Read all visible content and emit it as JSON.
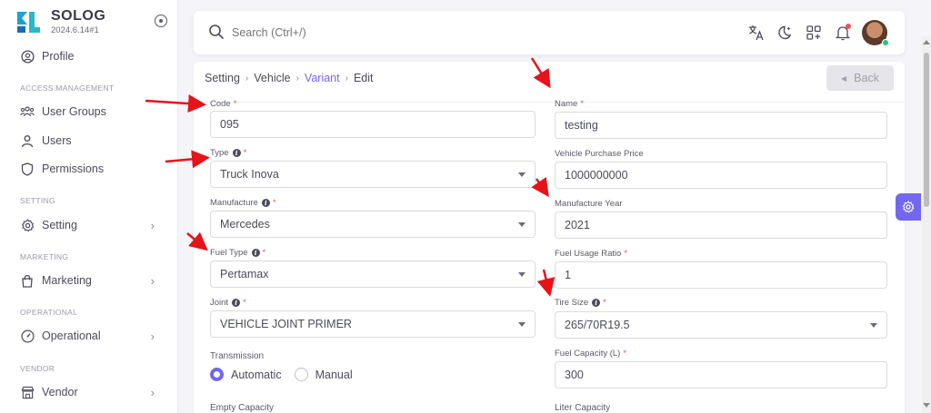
{
  "brand": {
    "name": "SOLOG",
    "version": "2024.6.14#1"
  },
  "sidebar": {
    "profile": "Profile",
    "sections": [
      {
        "header": "ACCESS MANAGEMENT",
        "items": [
          "User Groups",
          "Users",
          "Permissions"
        ]
      },
      {
        "header": "SETTING",
        "items": [
          "Setting"
        ]
      },
      {
        "header": "MARKETING",
        "items": [
          "Marketing"
        ]
      },
      {
        "header": "OPERATIONAL",
        "items": [
          "Operational"
        ]
      },
      {
        "header": "VENDOR",
        "items": [
          "Vendor"
        ]
      }
    ]
  },
  "search": {
    "placeholder": "Search (Ctrl+/)"
  },
  "breadcrumb": [
    "Setting",
    "Vehicle",
    "Variant",
    "Edit"
  ],
  "back_label": "Back",
  "form": {
    "code": {
      "label": "Code",
      "value": "095"
    },
    "name": {
      "label": "Name",
      "value": "testing"
    },
    "type": {
      "label": "Type",
      "value": "Truck Inova"
    },
    "purchase_price": {
      "label": "Vehicle Purchase Price",
      "value": "1000000000"
    },
    "manufacture": {
      "label": "Manufacture",
      "value": "Mercedes"
    },
    "manufacture_year": {
      "label": "Manufacture Year",
      "value": "2021"
    },
    "fuel_type": {
      "label": "Fuel Type",
      "value": "Pertamax"
    },
    "fuel_usage_ratio": {
      "label": "Fuel Usage Ratio",
      "value": "1"
    },
    "joint": {
      "label": "Joint",
      "value": "VEHICLE JOINT PRIMER"
    },
    "tire_size": {
      "label": "Tire Size",
      "value": "265/70R19.5"
    },
    "transmission": {
      "label": "Transmission",
      "options": [
        "Automatic",
        "Manual"
      ],
      "selected": "Automatic"
    },
    "fuel_capacity": {
      "label": "Fuel Capacity (L)",
      "value": "300"
    },
    "empty_capacity": {
      "label": "Empty Capacity"
    },
    "liter_capacity": {
      "label": "Liter Capacity"
    }
  },
  "colors": {
    "primary": "#7367f0",
    "required": "#ea5455",
    "online": "#28c76f",
    "annotation": "#e8121a"
  }
}
